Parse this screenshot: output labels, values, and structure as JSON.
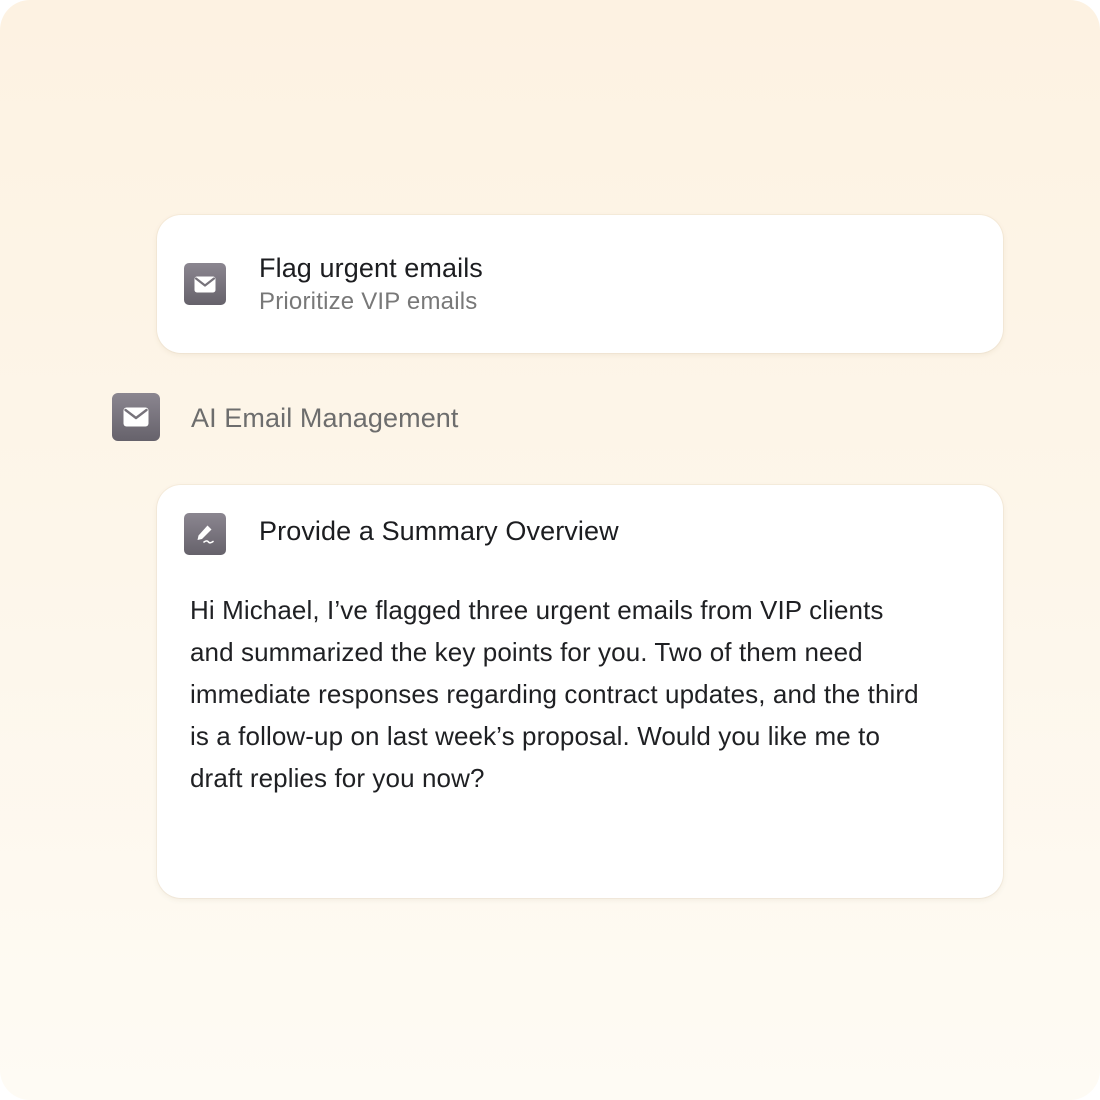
{
  "flag_card": {
    "icon": "mail-icon",
    "title": "Flag urgent emails",
    "subtitle": "Prioritize VIP emails"
  },
  "section": {
    "icon": "mail-icon",
    "label": "AI Email Management"
  },
  "summary_card": {
    "icon": "pen-signature-icon",
    "title": "Provide a Summary Overview",
    "body": "Hi Michael, I’ve flagged three urgent emails from VIP clients and summarized the key points for you. Two of them need immediate responses regarding contract updates, and the third is a follow-up on last week’s proposal. Would you like me to draft replies for you now?"
  },
  "colors": {
    "background_top": "#fdf2e2",
    "background_bottom": "#fefbf4",
    "card": "#ffffff",
    "icon_tile": "#77737b",
    "title_text": "#1c1d20",
    "muted_text": "#787878"
  }
}
